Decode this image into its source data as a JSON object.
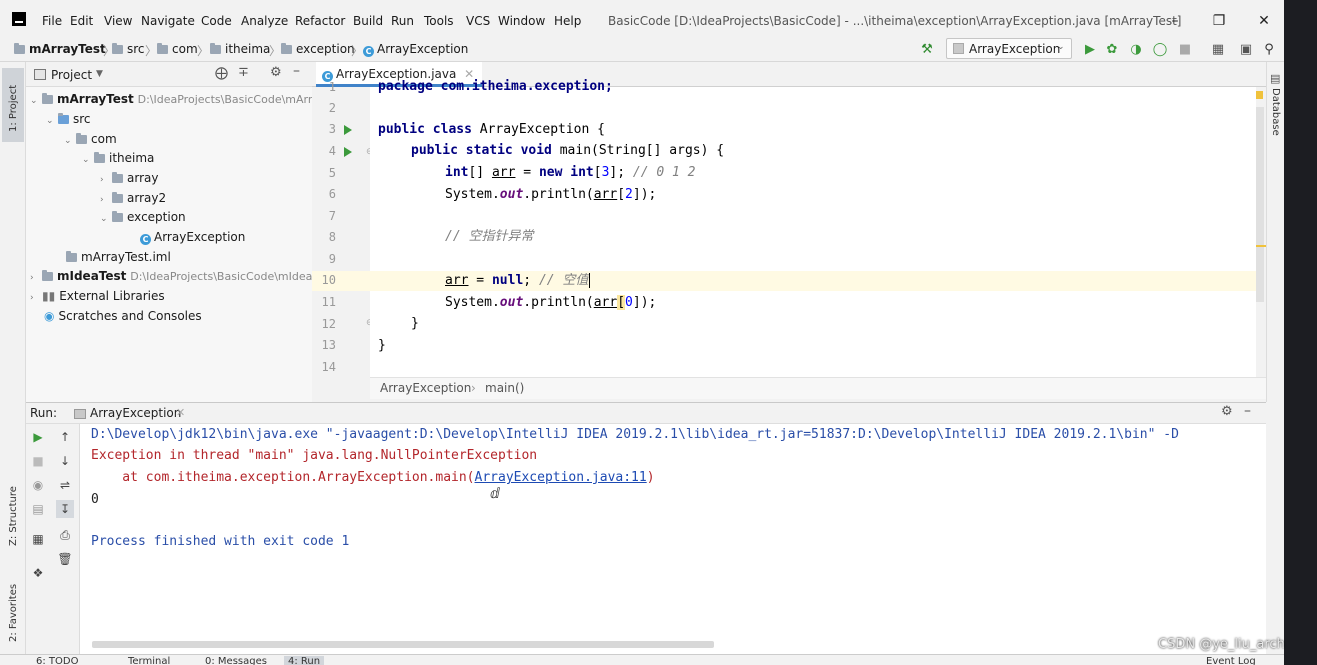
{
  "menu": [
    "File",
    "Edit",
    "View",
    "Navigate",
    "Code",
    "Analyze",
    "Refactor",
    "Build",
    "Run",
    "Tools",
    "VCS",
    "Window",
    "Help"
  ],
  "window_title": "BasicCode [D:\\IdeaProjects\\BasicCode] - ...\\itheima\\exception\\ArrayException.java [mArrayTest]",
  "navbar": {
    "crumbs": [
      "mArrayTest",
      "src",
      "com",
      "itheima",
      "exception",
      "ArrayException"
    ],
    "run_config": "ArrayException"
  },
  "left_stripe": {
    "project": "1: Project",
    "structure": "Z: Structure",
    "favorites": "2: Favorites"
  },
  "right_stripe": {
    "database": "Database"
  },
  "project_panel": {
    "title": "Project",
    "tree": [
      {
        "label": "mArrayTest",
        "path": "D:\\IdeaProjects\\BasicCode\\mArr"
      },
      {
        "label": "src"
      },
      {
        "label": "com"
      },
      {
        "label": "itheima"
      },
      {
        "label": "array"
      },
      {
        "label": "array2"
      },
      {
        "label": "exception"
      },
      {
        "label": "ArrayException"
      },
      {
        "label": "mArrayTest.iml"
      },
      {
        "label": "mIdeaTest",
        "path": "D:\\IdeaProjects\\BasicCode\\mIdea"
      },
      {
        "label": "External Libraries"
      },
      {
        "label": "Scratches and Consoles"
      }
    ]
  },
  "editor": {
    "tab": "ArrayException.java",
    "line_numbers": [
      "1",
      "2",
      "3",
      "4",
      "5",
      "6",
      "7",
      "8",
      "9",
      "10",
      "11",
      "12",
      "13",
      "14"
    ],
    "code": {
      "l1": "package com.itheima.exception;",
      "l3_kw": "public class",
      "l3_rest": " ArrayException {",
      "l4_kw": "public static void",
      "l4_rest": " main(String[] args) {",
      "l5_kw1": "int",
      "l5_a": "[] ",
      "l5_var": "arr",
      "l5_b": " = ",
      "l5_kw2": "new",
      "l5_c": " ",
      "l5_kw3": "int",
      "l5_d": "[",
      "l5_num": "3",
      "l5_e": "]; ",
      "l5_cm": "// 0 1 2",
      "l6_a": "System.",
      "l6_st": "out",
      "l6_b": ".println(",
      "l6_var": "arr",
      "l6_c": "[",
      "l6_num": "2",
      "l6_d": "]);",
      "l8_cm": "// 空指针异常",
      "l10_var": "arr",
      "l10_a": " = ",
      "l10_kw": "null",
      "l10_b": "; ",
      "l10_cm": "// 空值",
      "l11_a": "System.",
      "l11_st": "out",
      "l11_b": ".println(",
      "l11_var": "arr",
      "l11_c": "[",
      "l11_num": "0",
      "l11_d": "]);",
      "l12": "}",
      "l13": "}"
    },
    "breadcrumb": [
      "ArrayException",
      "main()"
    ]
  },
  "run_panel": {
    "label": "Run:",
    "tab": "ArrayException",
    "console": {
      "cmd": "D:\\Develop\\jdk12\\bin\\java.exe \"-javaagent:D:\\Develop\\IntelliJ IDEA 2019.2.1\\lib\\idea_rt.jar=51837:D:\\Develop\\IntelliJ IDEA 2019.2.1\\bin\" -D",
      "exception": "Exception in thread \"main\" java.lang.NullPointerException",
      "at_prefix": "    at com.itheima.exception.ArrayException.main(",
      "at_link": "ArrayException.java:11",
      "at_suffix": ")",
      "output": "0",
      "finished": "Process finished with exit code 1"
    }
  },
  "statusbar": {
    "todo": "6: TODO",
    "terminal": "Terminal",
    "messages": "0: Messages",
    "run": "4: Run",
    "event_log": "Event Log"
  },
  "watermark": "CSDN @ye_liu_arch",
  "colors": {
    "keyword": "#000080",
    "comment": "#808080",
    "error": "#b3262b",
    "link": "#1d4ab3",
    "current_line": "#fffae3",
    "tab_underline": "#4083c9"
  }
}
